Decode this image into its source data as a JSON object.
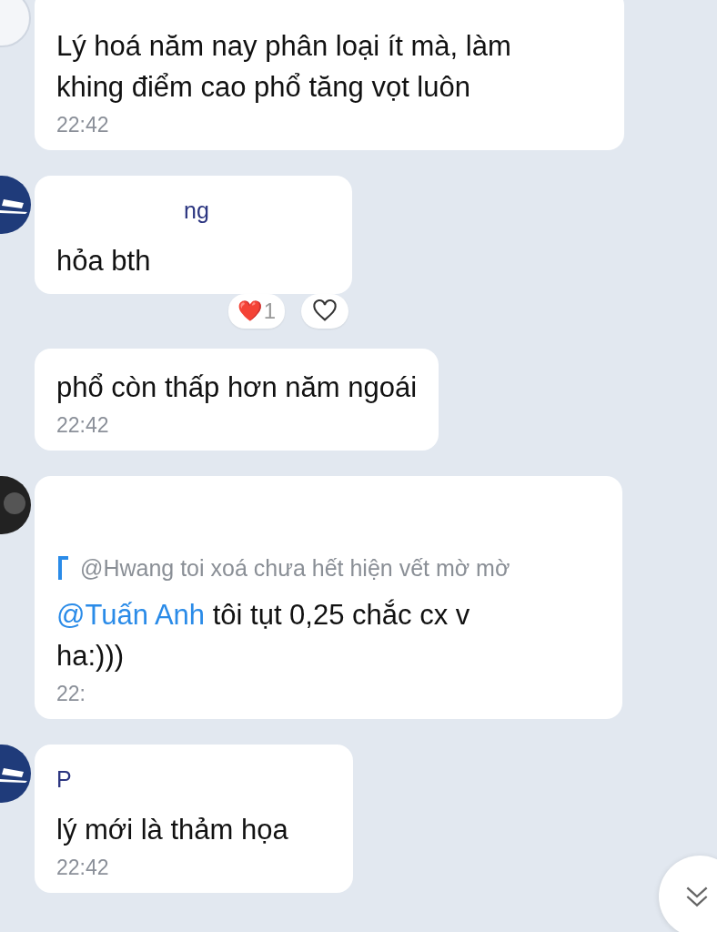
{
  "messages": [
    {
      "avatar": {
        "kind": "light"
      },
      "text": "Lý hoá năm nay phân loại ít mà, làm\nkhing điểm cao phổ tăng vọt luôn",
      "time": "22:42"
    },
    {
      "avatar": {
        "kind": "logo"
      },
      "sender": "ng",
      "text": "hỏa bth",
      "reactions": {
        "emoji": "❤️",
        "count": "1"
      }
    },
    {
      "text": "phổ còn thấp hơn năm ngoái",
      "time": "22:42"
    },
    {
      "avatar": {
        "kind": "dark"
      },
      "quote": "@Hwang toi xoá chưa hết hiện vết mờ mờ",
      "mention": "@Tuấn Anh",
      "text": "tôi tụt 0,25 chắc cx v\nha:)))",
      "time": "22:"
    },
    {
      "avatar": {
        "kind": "logo"
      },
      "sender": "P",
      "text": "lý mới là thảm họa",
      "time": "22:42"
    }
  ],
  "scroll_button": {
    "kind": "scroll-down"
  }
}
